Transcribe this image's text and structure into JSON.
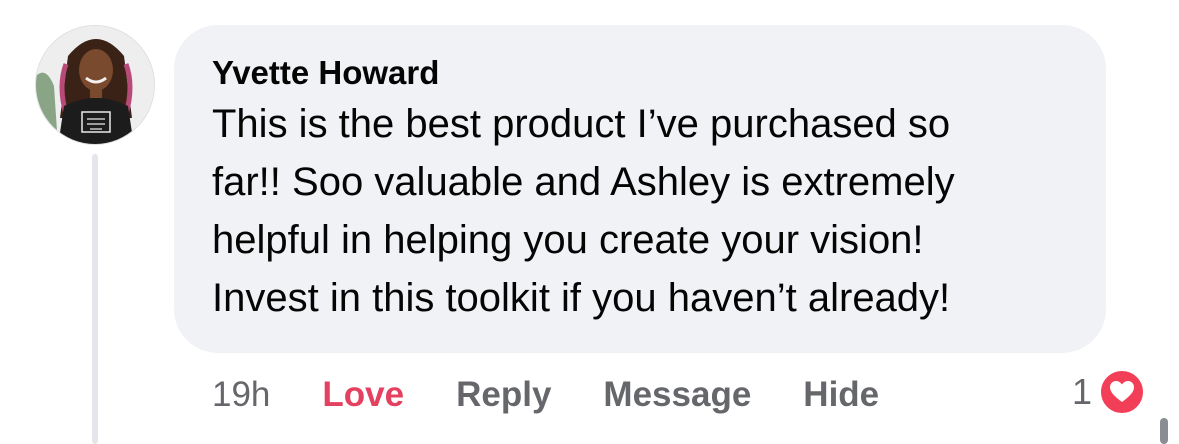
{
  "comment": {
    "author": "Yvette Howard",
    "avatar_icon": "profile-photo",
    "text": "This is the best product I’ve purchased so\nfar!! Soo valuable and Ashley is extremely\nhelpful in helping you create your vision!\nInvest in this toolkit if you haven’t already!"
  },
  "actions": {
    "time": "19h",
    "love": "Love",
    "reply": "Reply",
    "message": "Message",
    "hide": "Hide"
  },
  "reactions": {
    "count": "1",
    "icon": "heart-icon"
  },
  "colors": {
    "bubble": "#f0f2f5",
    "love": "#e4405f",
    "heart": "#f33e58",
    "muted": "#65676b"
  }
}
